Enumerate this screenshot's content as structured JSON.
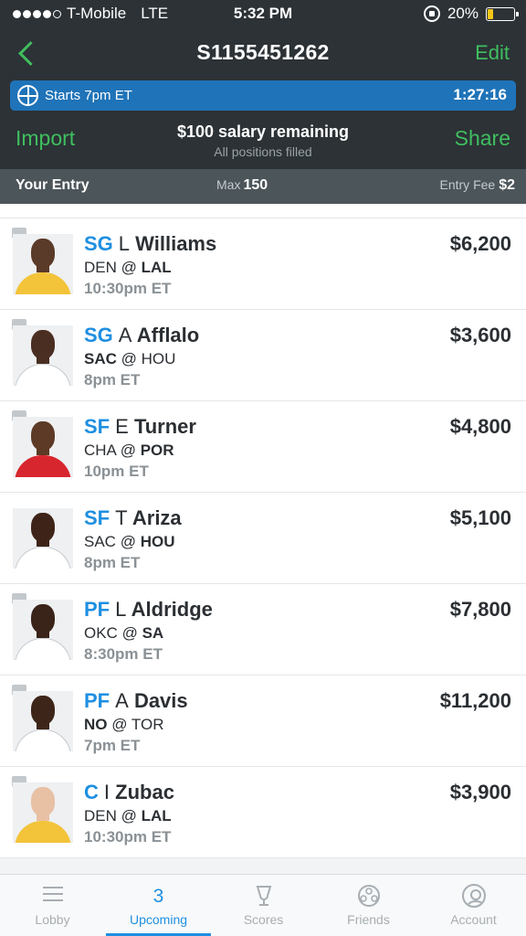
{
  "status_bar": {
    "carrier": "T-Mobile",
    "network": "LTE",
    "time": "5:32 PM",
    "battery": "20%",
    "battery_level": 0.2,
    "signal_dots_filled": 4,
    "signal_dots_total": 5
  },
  "header": {
    "title": "S1155451262",
    "edit_label": "Edit",
    "starts_text": "Starts 7pm ET",
    "countdown": "1:27:16",
    "import_label": "Import",
    "share_label": "Share",
    "salary_remaining": "$100 salary remaining",
    "positions_status": "All positions filled"
  },
  "entry_bar": {
    "your_entry_label": "Your Entry",
    "max_label": "Max",
    "max_value": "150",
    "entry_fee_label": "Entry Fee",
    "entry_fee_value": "$2"
  },
  "players": [
    {
      "pos": "SG",
      "initial": "L",
      "last": "Williams",
      "team": "DEN",
      "at": "@",
      "opp": "LAL",
      "bold_team": "opp",
      "time": "10:30pm ET",
      "salary": "$6,200",
      "has_note": true,
      "skin": "#5a3a28",
      "jersey": "#f3c33a"
    },
    {
      "pos": "SG",
      "initial": "A",
      "last": "Afflalo",
      "team": "SAC",
      "at": "@",
      "opp": "HOU",
      "bold_team": "team",
      "time": "8pm ET",
      "salary": "$3,600",
      "has_note": true,
      "skin": "#4a2e22",
      "jersey": "#ffffff"
    },
    {
      "pos": "SF",
      "initial": "E",
      "last": "Turner",
      "team": "CHA",
      "at": "@",
      "opp": "POR",
      "bold_team": "opp",
      "time": "10pm ET",
      "salary": "$4,800",
      "has_note": true,
      "skin": "#5c3a26",
      "jersey": "#d8262e"
    },
    {
      "pos": "SF",
      "initial": "T",
      "last": "Ariza",
      "team": "SAC",
      "at": "@",
      "opp": "HOU",
      "bold_team": "opp",
      "time": "8pm ET",
      "salary": "$5,100",
      "has_note": false,
      "skin": "#3e2418",
      "jersey": "#ffffff"
    },
    {
      "pos": "PF",
      "initial": "L",
      "last": "Aldridge",
      "team": "OKC",
      "at": "@",
      "opp": "SA",
      "bold_team": "opp",
      "time": "8:30pm ET",
      "salary": "$7,800",
      "has_note": true,
      "skin": "#3a2318",
      "jersey": "#ffffff"
    },
    {
      "pos": "PF",
      "initial": "A",
      "last": "Davis",
      "team": "NO",
      "at": "@",
      "opp": "TOR",
      "bold_team": "team",
      "time": "7pm ET",
      "salary": "$11,200",
      "has_note": true,
      "skin": "#3d2519",
      "jersey": "#ffffff"
    },
    {
      "pos": "C",
      "initial": "I",
      "last": "Zubac",
      "team": "DEN",
      "at": "@",
      "opp": "LAL",
      "bold_team": "opp",
      "time": "10:30pm ET",
      "salary": "$3,900",
      "has_note": true,
      "skin": "#e8c0a4",
      "jersey": "#f3c33a"
    }
  ],
  "tabs": [
    {
      "label": "Lobby",
      "icon": "list-icon",
      "active": false
    },
    {
      "label": "Upcoming",
      "icon": "count-badge",
      "count": "3",
      "active": true
    },
    {
      "label": "Scores",
      "icon": "trophy-icon",
      "active": false
    },
    {
      "label": "Friends",
      "icon": "friends-icon",
      "active": false
    },
    {
      "label": "Account",
      "icon": "account-icon",
      "active": false
    }
  ],
  "colors": {
    "header_bg": "#2c3236",
    "accent_green": "#3fbf5f",
    "accent_blue": "#1e8fe1",
    "starts_bar_bg": "#1f73b8",
    "entry_bar_bg": "#4c5559"
  }
}
